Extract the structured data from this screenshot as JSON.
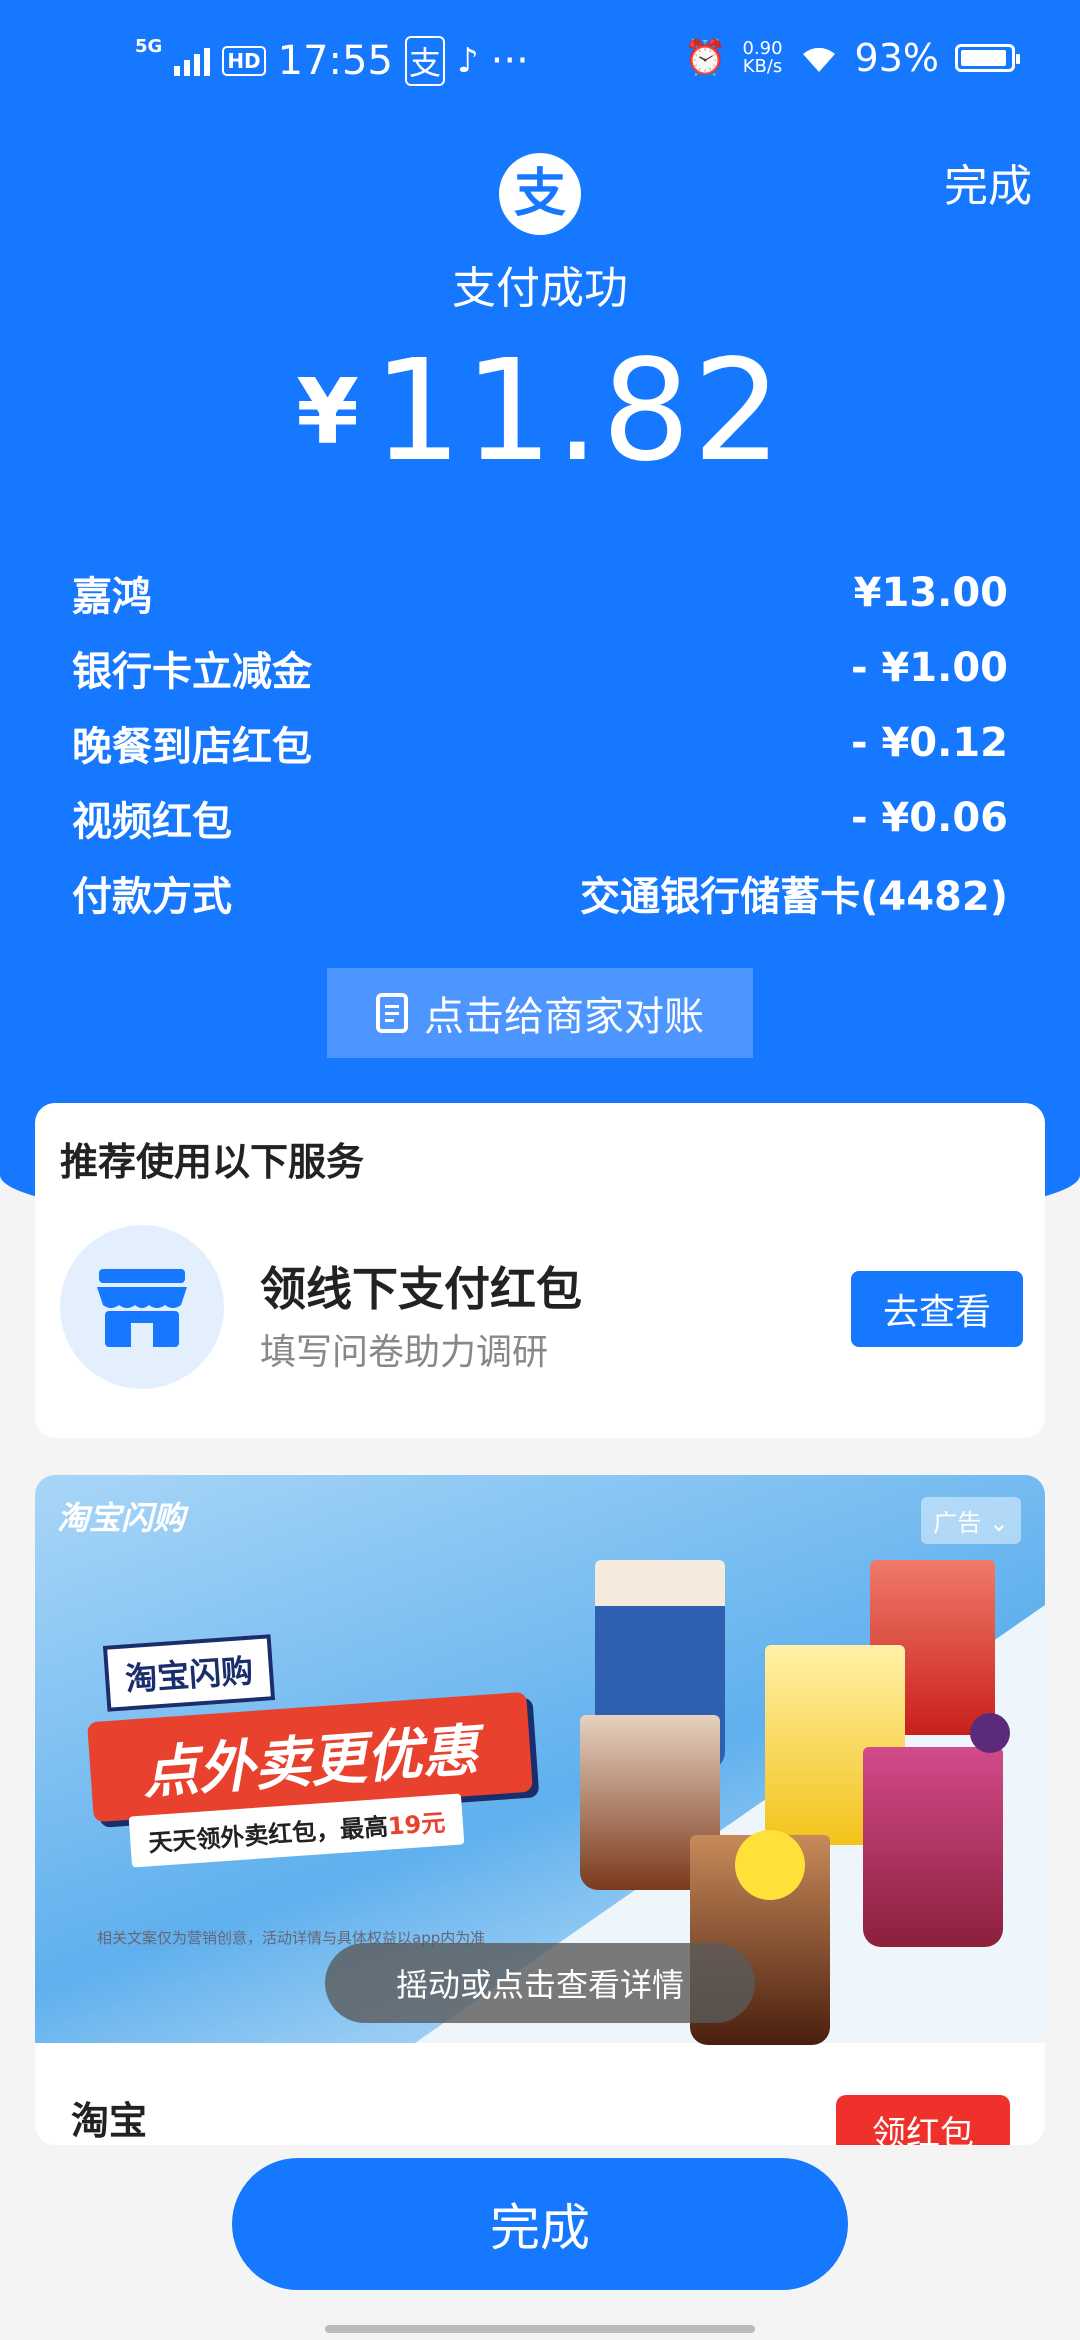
{
  "status_bar": {
    "network": "5G",
    "hd": "HD",
    "time": "17:55",
    "alipay_glyph": "支",
    "more": "···",
    "net_speed_value": "0.90",
    "net_speed_unit": "KB/s",
    "battery_percent": "93%",
    "battery_level": 0.93
  },
  "header": {
    "done_label": "完成",
    "logo_glyph": "支",
    "title": "支付成功",
    "currency": "¥",
    "amount": "11.82"
  },
  "details": [
    {
      "label": "嘉鸿",
      "value": "¥13.00"
    },
    {
      "label": "银行卡立减金",
      "value": "- ¥1.00"
    },
    {
      "label": "晚餐到店红包",
      "value": "- ¥0.12"
    },
    {
      "label": "视频红包",
      "value": "- ¥0.06"
    },
    {
      "label": "付款方式",
      "value": "交通银行储蓄卡(4482)"
    }
  ],
  "reconcile_button": "点击给商家对账",
  "services": {
    "title": "推荐使用以下服务",
    "item_title": "领线下支付红包",
    "item_subtitle": "填写问卷助力调研",
    "button": "去查看"
  },
  "ad": {
    "brand": "淘宝闪购",
    "tag": "广告",
    "banner_tag": "淘宝闪购",
    "headline": "点外卖更优惠",
    "sub_prefix": "天天领外卖红包，最高",
    "sub_highlight": "19元",
    "disclaimer": "相关文案仅为营销创意，活动详情与具体权益以app内为准",
    "shake_hint": "摇动或点击查看详情",
    "merchant": "淘宝",
    "button": "领红包"
  },
  "footer": {
    "done_label": "完成"
  },
  "colors": {
    "primary": "#1677ff",
    "red": "#f0302a"
  }
}
